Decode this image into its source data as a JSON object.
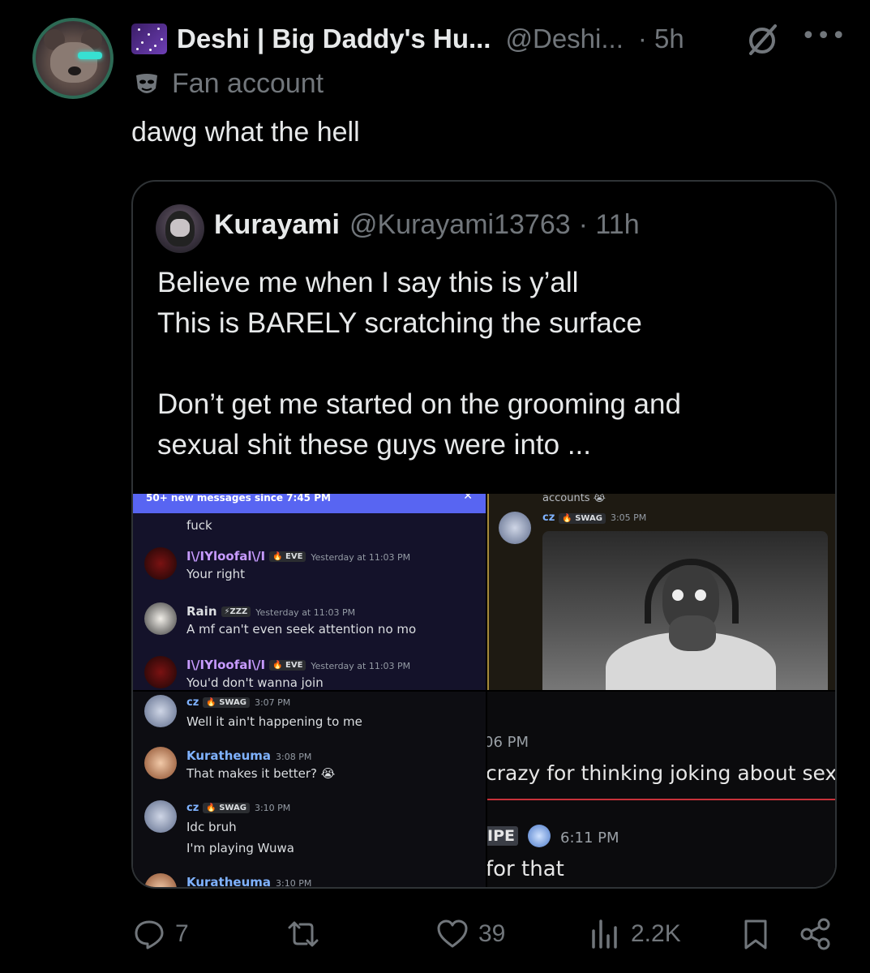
{
  "author": {
    "display_name": "Deshi | Big Daddy's Hu...",
    "handle": "@Deshi...",
    "time": "· 5h",
    "label": "Fan account"
  },
  "tweet": {
    "text": "dawg what the hell"
  },
  "quote": {
    "display_name": "Kurayami",
    "handle": "@Kurayami13763",
    "time": "· 11h",
    "lines": [
      "Believe me when I say this is y’all",
      "This is BARELY scratching the surface",
      "Don’t get me started on the grooming and",
      "sexual shit these guys were into ..."
    ]
  },
  "media": {
    "top_left": {
      "banner": "50+ new messages since 7:45 PM",
      "first_line": "fuck",
      "messages": [
        {
          "name": "I\\/IYloofal\\/I",
          "tag": "EVE",
          "time": "Yesterday at 11:03 PM",
          "text": "Your right"
        },
        {
          "name": "Rain",
          "tag": "ZZZ",
          "time": "Yesterday at 11:03 PM",
          "text": "A mf can't even seek attention no mo"
        },
        {
          "name": "I\\/IYloofal\\/I",
          "tag": "EVE",
          "time": "Yesterday at 11:03 PM",
          "text": "You'd don't wanna join"
        }
      ]
    },
    "top_right": {
      "accounts_text": "accounts",
      "name": "cz",
      "tag": "SWAG",
      "time": "3:05 PM"
    },
    "bottom_left": {
      "messages": [
        {
          "name": "cz",
          "tag": "SWAG",
          "time": "3:07 PM",
          "text": "Well it ain't happening to me",
          "text2": ""
        },
        {
          "name": "Kuratheuma",
          "tag": "",
          "time": "3:08 PM",
          "text": "That makes it better? 😭",
          "text2": ""
        },
        {
          "name": "cz",
          "tag": "SWAG",
          "time": "3:10 PM",
          "text": "Idc bruh",
          "text2": "I'm playing Wuwa"
        },
        {
          "name": "Kuratheuma",
          "tag": "",
          "time": "3:10 PM",
          "text": "",
          "text2": ""
        }
      ]
    },
    "bottom_right": {
      "time1": "06 PM",
      "text1": "crazy for thinking joking about sexua",
      "name": "IPE",
      "time2": "6:11 PM",
      "text2": "for that"
    }
  },
  "actions": {
    "replies": "7",
    "retweets": "",
    "likes": "39",
    "views": "2.2K"
  },
  "colors": {
    "background": "#000000",
    "text": "#e7e9ea",
    "secondary": "#71767b",
    "border": "#2f3336",
    "discord_blurple": "#5865f2"
  }
}
